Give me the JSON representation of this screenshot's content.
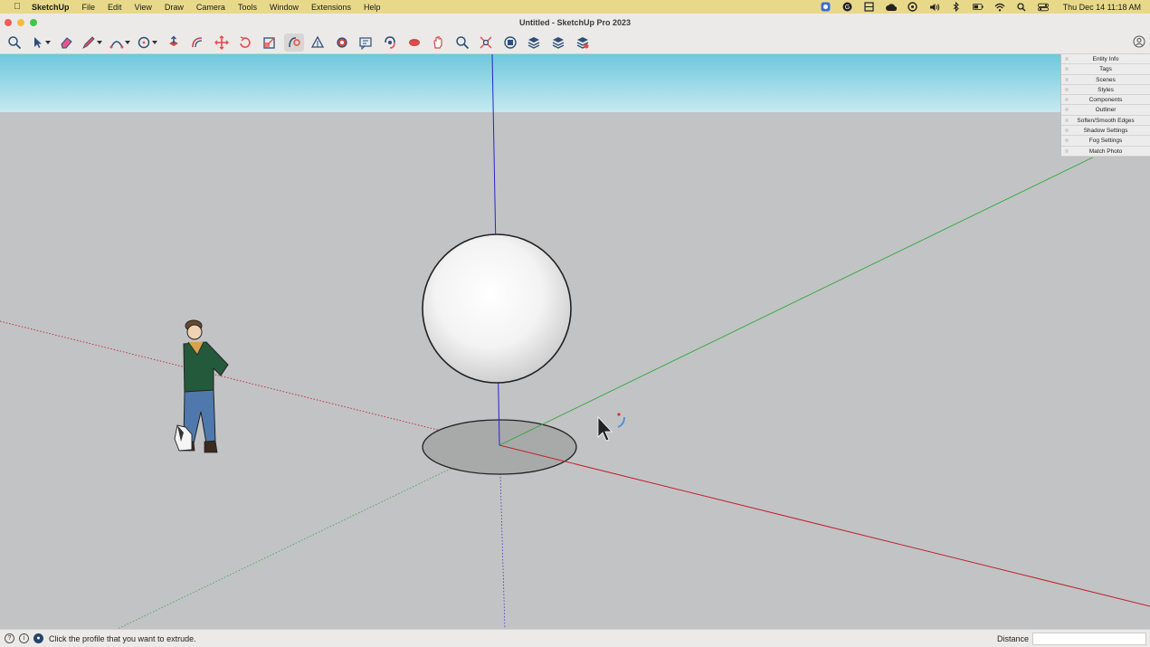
{
  "menubar": {
    "apple_icon": "apple-logo-icon",
    "app_name": "SketchUp",
    "items": [
      "File",
      "Edit",
      "View",
      "Draw",
      "Camera",
      "Tools",
      "Window",
      "Extensions",
      "Help"
    ],
    "clock": "Thu Dec 14  11:18 AM"
  },
  "window": {
    "title": "Untitled - SketchUp Pro 2023"
  },
  "toolbar": {
    "tools": [
      {
        "name": "search-icon",
        "dropdown": false,
        "active": false
      },
      {
        "name": "select-arrow-icon",
        "dropdown": true,
        "active": false
      },
      {
        "name": "eraser-icon",
        "dropdown": false,
        "active": false
      },
      {
        "name": "pencil-line-icon",
        "dropdown": true,
        "active": false
      },
      {
        "name": "arc-icon",
        "dropdown": true,
        "active": false
      },
      {
        "name": "shapes-icon",
        "dropdown": true,
        "active": false
      },
      {
        "name": "push-pull-icon",
        "dropdown": false,
        "active": false
      },
      {
        "name": "offset-icon",
        "dropdown": false,
        "active": false
      },
      {
        "name": "move-icon",
        "dropdown": false,
        "active": false
      },
      {
        "name": "rotate-icon",
        "dropdown": false,
        "active": false
      },
      {
        "name": "scale-icon",
        "dropdown": false,
        "active": false
      },
      {
        "name": "follow-me-icon",
        "dropdown": false,
        "active": true
      },
      {
        "name": "tape-measure-icon",
        "dropdown": false,
        "active": false
      },
      {
        "name": "paint-bucket-icon",
        "dropdown": false,
        "active": false
      },
      {
        "name": "text-label-icon",
        "dropdown": false,
        "active": false
      },
      {
        "name": "orbit-icon",
        "dropdown": false,
        "active": false
      },
      {
        "name": "section-plane-icon",
        "dropdown": false,
        "active": false
      },
      {
        "name": "pan-icon",
        "dropdown": false,
        "active": false
      },
      {
        "name": "zoom-icon",
        "dropdown": false,
        "active": false
      },
      {
        "name": "zoom-extents-icon",
        "dropdown": false,
        "active": false
      },
      {
        "name": "warehouse-icon",
        "dropdown": false,
        "active": false
      },
      {
        "name": "extension-warehouse-icon",
        "dropdown": false,
        "active": false
      },
      {
        "name": "layout-icon",
        "dropdown": false,
        "active": false
      },
      {
        "name": "extension-manager-icon",
        "dropdown": false,
        "active": false
      }
    ]
  },
  "tray": {
    "items": [
      "Entity Info",
      "Tags",
      "Scenes",
      "Styles",
      "Components",
      "Outliner",
      "Soften/Smooth Edges",
      "Shadow Settings",
      "Fog Settings",
      "Match Photo"
    ]
  },
  "statusbar": {
    "message": "Click the profile that you want to extrude.",
    "measure_label": "Distance",
    "measure_value": ""
  },
  "colors": {
    "menubar_bg": "#e8d98a",
    "sky_top": "#6ec8dc",
    "ground": "#c2c3c5",
    "axis_red": "#c0232b",
    "axis_green": "#2ea83a",
    "axis_blue": "#2626c8"
  }
}
